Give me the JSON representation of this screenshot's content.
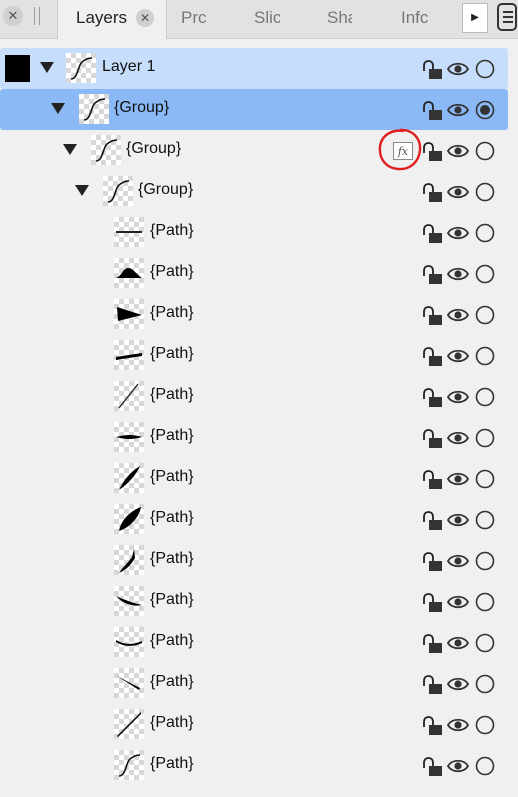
{
  "tabs": [
    {
      "label": "Layers",
      "active": true
    },
    {
      "label": "Prc",
      "active": false
    },
    {
      "label": "Slic",
      "active": false
    },
    {
      "label": "Sha",
      "active": false
    },
    {
      "label": "Infc",
      "active": false
    }
  ],
  "layers": [
    {
      "label": "Layer 1",
      "selection": "light",
      "has_swatch": true,
      "expanded": true,
      "radio": "empty",
      "thumb": "curve"
    },
    {
      "label": "{Group}",
      "selection": "selected",
      "has_swatch": false,
      "expanded": true,
      "radio": "filled",
      "thumb": "curve"
    },
    {
      "label": "{Group}",
      "selection": "none",
      "has_swatch": false,
      "expanded": true,
      "radio": "empty",
      "thumb": "curve",
      "fx": "fx",
      "annotated": true
    },
    {
      "label": "{Group}",
      "selection": "none",
      "has_swatch": false,
      "expanded": true,
      "radio": "empty",
      "thumb": "curve"
    },
    {
      "label": "{Path}",
      "selection": "none",
      "radio": "empty",
      "thumb": "hline"
    },
    {
      "label": "{Path}",
      "selection": "none",
      "radio": "empty",
      "thumb": "mound"
    },
    {
      "label": "{Path}",
      "selection": "none",
      "radio": "empty",
      "thumb": "wedge"
    },
    {
      "label": "{Path}",
      "selection": "none",
      "radio": "empty",
      "thumb": "thickline"
    },
    {
      "label": "{Path}",
      "selection": "none",
      "radio": "empty",
      "thumb": "diag-thin"
    },
    {
      "label": "{Path}",
      "selection": "none",
      "radio": "empty",
      "thumb": "lens"
    },
    {
      "label": "{Path}",
      "selection": "none",
      "radio": "empty",
      "thumb": "feather"
    },
    {
      "label": "{Path}",
      "selection": "none",
      "radio": "empty",
      "thumb": "leaf"
    },
    {
      "label": "{Path}",
      "selection": "none",
      "radio": "empty",
      "thumb": "brush"
    },
    {
      "label": "{Path}",
      "selection": "none",
      "radio": "empty",
      "thumb": "swoosh"
    },
    {
      "label": "{Path}",
      "selection": "none",
      "radio": "empty",
      "thumb": "smile"
    },
    {
      "label": "{Path}",
      "selection": "none",
      "radio": "empty",
      "thumb": "diag-short"
    },
    {
      "label": "{Path}",
      "selection": "none",
      "radio": "empty",
      "thumb": "diag-long"
    },
    {
      "label": "{Path}",
      "selection": "none",
      "radio": "empty",
      "thumb": "curve"
    }
  ],
  "icons": {
    "panel_close": "close-icon",
    "tab_close": "close-icon",
    "overflow": "play-arrow-icon",
    "menu": "hamburger-menu-icon",
    "lock": "unlocked-padlock-icon",
    "visibility": "eye-icon",
    "select": "radio-circle-icon",
    "effects": "fx-icon"
  },
  "colors": {
    "selected_row": "#8ab9f5",
    "parent_row": "#c6defb",
    "annotation": "#e02020"
  }
}
